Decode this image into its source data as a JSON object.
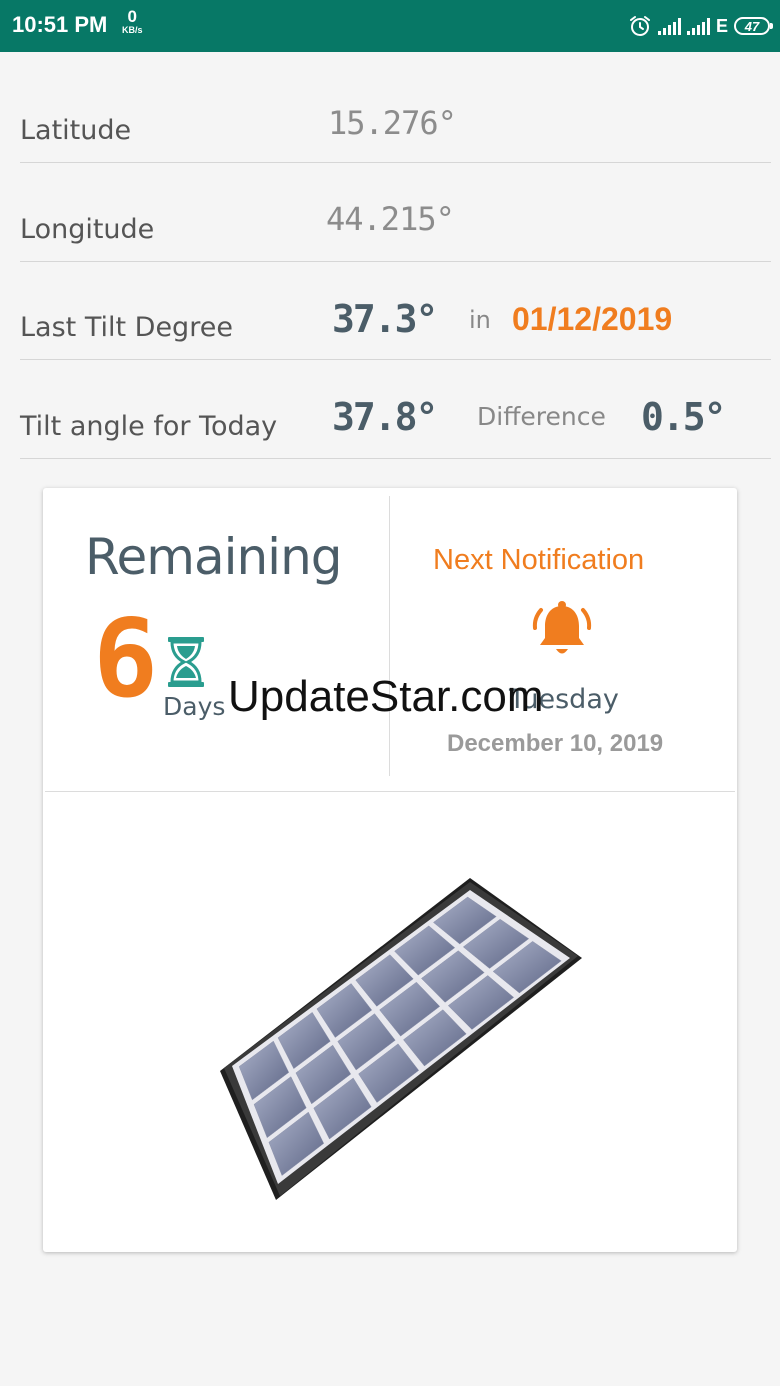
{
  "status_bar": {
    "time": "10:51 PM",
    "net_speed_value": "0",
    "net_speed_unit": "KB/s",
    "network_type": "E",
    "battery": "47",
    "icons": [
      "alarm-icon",
      "signal-icon",
      "signal-icon",
      "battery-icon"
    ]
  },
  "rows": {
    "latitude": {
      "label": "Latitude",
      "value": "15.276°"
    },
    "longitude": {
      "label": "Longitude",
      "value": "44.215°"
    },
    "last_tilt": {
      "label": "Last Tilt Degree",
      "value": "37.3°",
      "in_label": "in",
      "date": "01/12/2019"
    },
    "today_tilt": {
      "label": "Tilt angle for Today",
      "value": "37.8°",
      "difference_label": "Difference",
      "difference_value": "0.5°"
    }
  },
  "card": {
    "remaining_label": "Remaining",
    "remaining_count": "6",
    "remaining_unit": "Days",
    "next_notification_label": "Next Notification",
    "next_weekday": "Tuesday",
    "next_date": "December 10, 2019",
    "icons": [
      "hourglass-icon",
      "bell-icon",
      "solar-panel-image"
    ]
  },
  "watermark": "UpdateStar.com",
  "colors": {
    "status_bar": "#077866",
    "accent_orange": "#f07d1f",
    "dark_slate": "#4b5d68",
    "teal": "#2a9d8f"
  }
}
